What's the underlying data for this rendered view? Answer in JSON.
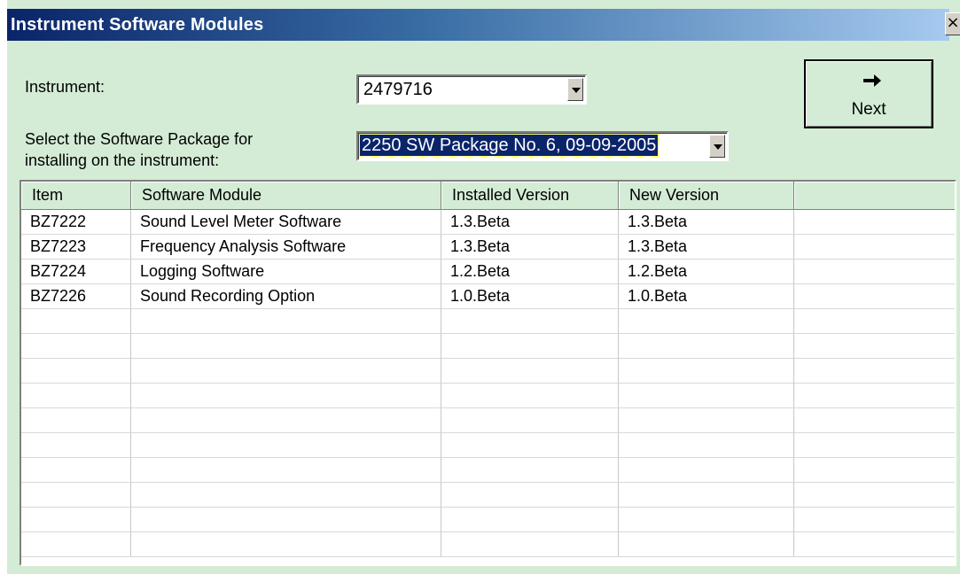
{
  "window": {
    "title": "Instrument Software Modules",
    "close_glyph": "×"
  },
  "instrument": {
    "label": "Instrument:",
    "value": "2479716"
  },
  "package": {
    "label_line1": "Select the Software Package for",
    "label_line2": "installing on the instrument:",
    "value": "2250 SW Package No. 6, 09-09-2005"
  },
  "next_button": {
    "label": "Next",
    "icon": "right-arrow-icon"
  },
  "table": {
    "headers": [
      "Item",
      "Software Module",
      "Installed Version",
      "New Version",
      ""
    ],
    "rows": [
      [
        "BZ7222",
        "Sound Level Meter Software",
        "1.3.Beta",
        "1.3.Beta",
        ""
      ],
      [
        "BZ7223",
        "Frequency Analysis Software",
        "1.3.Beta",
        "1.3.Beta",
        ""
      ],
      [
        "BZ7224",
        "Logging Software",
        "1.2.Beta",
        "1.2.Beta",
        ""
      ],
      [
        "BZ7226",
        "Sound Recording Option",
        "1.0.Beta",
        "1.0.Beta",
        ""
      ],
      [
        "",
        "",
        "",
        "",
        ""
      ],
      [
        "",
        "",
        "",
        "",
        ""
      ],
      [
        "",
        "",
        "",
        "",
        ""
      ],
      [
        "",
        "",
        "",
        "",
        ""
      ],
      [
        "",
        "",
        "",
        "",
        ""
      ],
      [
        "",
        "",
        "",
        "",
        ""
      ],
      [
        "",
        "",
        "",
        "",
        ""
      ],
      [
        "",
        "",
        "",
        "",
        ""
      ],
      [
        "",
        "",
        "",
        "",
        ""
      ],
      [
        "",
        "",
        "",
        "",
        ""
      ]
    ]
  },
  "colors": {
    "dialog_background": "#d4ecd6",
    "titlebar_start": "#0a246a",
    "titlebar_end": "#a6caf0",
    "selection": "#0a246a"
  }
}
